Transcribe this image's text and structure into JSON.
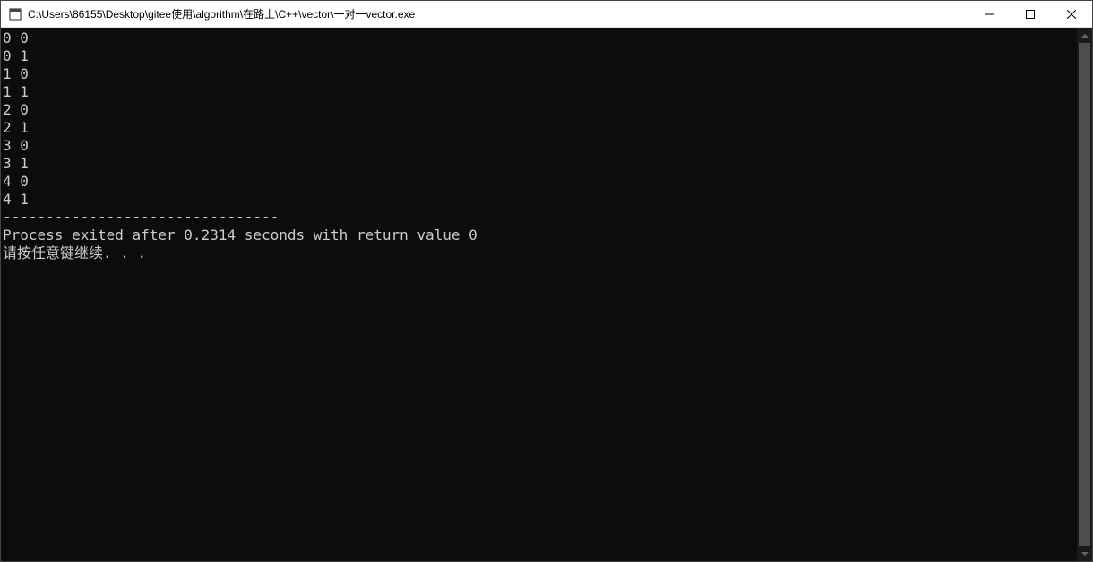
{
  "window": {
    "title": "C:\\Users\\86155\\Desktop\\gitee使用\\algorithm\\在路上\\C++\\vector\\一对一vector.exe"
  },
  "console": {
    "lines": [
      "0 0",
      "0 1",
      "1 0",
      "1 1",
      "2 0",
      "2 1",
      "3 0",
      "3 1",
      "4 0",
      "4 1",
      "",
      "--------------------------------",
      "Process exited after 0.2314 seconds with return value 0",
      "请按任意键继续. . ."
    ]
  }
}
